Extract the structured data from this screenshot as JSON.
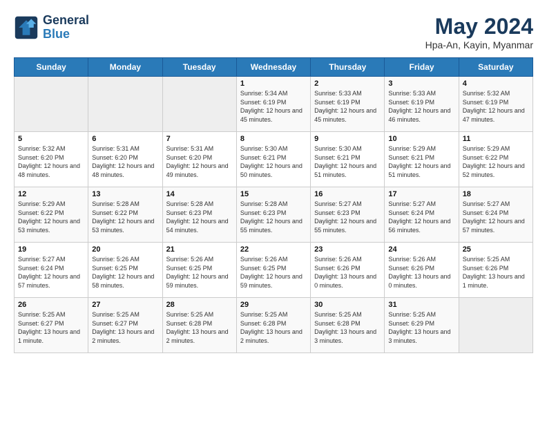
{
  "header": {
    "logo_line1": "General",
    "logo_line2": "Blue",
    "title": "May 2024",
    "subtitle": "Hpa-An, Kayin, Myanmar"
  },
  "days_of_week": [
    "Sunday",
    "Monday",
    "Tuesday",
    "Wednesday",
    "Thursday",
    "Friday",
    "Saturday"
  ],
  "weeks": [
    [
      {
        "day": "",
        "empty": true
      },
      {
        "day": "",
        "empty": true
      },
      {
        "day": "",
        "empty": true
      },
      {
        "day": "1",
        "sunrise": "5:34 AM",
        "sunset": "6:19 PM",
        "daylight": "12 hours and 45 minutes."
      },
      {
        "day": "2",
        "sunrise": "5:33 AM",
        "sunset": "6:19 PM",
        "daylight": "12 hours and 45 minutes."
      },
      {
        "day": "3",
        "sunrise": "5:33 AM",
        "sunset": "6:19 PM",
        "daylight": "12 hours and 46 minutes."
      },
      {
        "day": "4",
        "sunrise": "5:32 AM",
        "sunset": "6:19 PM",
        "daylight": "12 hours and 47 minutes."
      }
    ],
    [
      {
        "day": "5",
        "sunrise": "5:32 AM",
        "sunset": "6:20 PM",
        "daylight": "12 hours and 48 minutes."
      },
      {
        "day": "6",
        "sunrise": "5:31 AM",
        "sunset": "6:20 PM",
        "daylight": "12 hours and 48 minutes."
      },
      {
        "day": "7",
        "sunrise": "5:31 AM",
        "sunset": "6:20 PM",
        "daylight": "12 hours and 49 minutes."
      },
      {
        "day": "8",
        "sunrise": "5:30 AM",
        "sunset": "6:21 PM",
        "daylight": "12 hours and 50 minutes."
      },
      {
        "day": "9",
        "sunrise": "5:30 AM",
        "sunset": "6:21 PM",
        "daylight": "12 hours and 51 minutes."
      },
      {
        "day": "10",
        "sunrise": "5:29 AM",
        "sunset": "6:21 PM",
        "daylight": "12 hours and 51 minutes."
      },
      {
        "day": "11",
        "sunrise": "5:29 AM",
        "sunset": "6:22 PM",
        "daylight": "12 hours and 52 minutes."
      }
    ],
    [
      {
        "day": "12",
        "sunrise": "5:29 AM",
        "sunset": "6:22 PM",
        "daylight": "12 hours and 53 minutes."
      },
      {
        "day": "13",
        "sunrise": "5:28 AM",
        "sunset": "6:22 PM",
        "daylight": "12 hours and 53 minutes."
      },
      {
        "day": "14",
        "sunrise": "5:28 AM",
        "sunset": "6:23 PM",
        "daylight": "12 hours and 54 minutes."
      },
      {
        "day": "15",
        "sunrise": "5:28 AM",
        "sunset": "6:23 PM",
        "daylight": "12 hours and 55 minutes."
      },
      {
        "day": "16",
        "sunrise": "5:27 AM",
        "sunset": "6:23 PM",
        "daylight": "12 hours and 55 minutes."
      },
      {
        "day": "17",
        "sunrise": "5:27 AM",
        "sunset": "6:24 PM",
        "daylight": "12 hours and 56 minutes."
      },
      {
        "day": "18",
        "sunrise": "5:27 AM",
        "sunset": "6:24 PM",
        "daylight": "12 hours and 57 minutes."
      }
    ],
    [
      {
        "day": "19",
        "sunrise": "5:27 AM",
        "sunset": "6:24 PM",
        "daylight": "12 hours and 57 minutes."
      },
      {
        "day": "20",
        "sunrise": "5:26 AM",
        "sunset": "6:25 PM",
        "daylight": "12 hours and 58 minutes."
      },
      {
        "day": "21",
        "sunrise": "5:26 AM",
        "sunset": "6:25 PM",
        "daylight": "12 hours and 59 minutes."
      },
      {
        "day": "22",
        "sunrise": "5:26 AM",
        "sunset": "6:25 PM",
        "daylight": "12 hours and 59 minutes."
      },
      {
        "day": "23",
        "sunrise": "5:26 AM",
        "sunset": "6:26 PM",
        "daylight": "13 hours and 0 minutes."
      },
      {
        "day": "24",
        "sunrise": "5:26 AM",
        "sunset": "6:26 PM",
        "daylight": "13 hours and 0 minutes."
      },
      {
        "day": "25",
        "sunrise": "5:25 AM",
        "sunset": "6:26 PM",
        "daylight": "13 hours and 1 minute."
      }
    ],
    [
      {
        "day": "26",
        "sunrise": "5:25 AM",
        "sunset": "6:27 PM",
        "daylight": "13 hours and 1 minute."
      },
      {
        "day": "27",
        "sunrise": "5:25 AM",
        "sunset": "6:27 PM",
        "daylight": "13 hours and 2 minutes."
      },
      {
        "day": "28",
        "sunrise": "5:25 AM",
        "sunset": "6:28 PM",
        "daylight": "13 hours and 2 minutes."
      },
      {
        "day": "29",
        "sunrise": "5:25 AM",
        "sunset": "6:28 PM",
        "daylight": "13 hours and 2 minutes."
      },
      {
        "day": "30",
        "sunrise": "5:25 AM",
        "sunset": "6:28 PM",
        "daylight": "13 hours and 3 minutes."
      },
      {
        "day": "31",
        "sunrise": "5:25 AM",
        "sunset": "6:29 PM",
        "daylight": "13 hours and 3 minutes."
      },
      {
        "day": "",
        "empty": true
      }
    ]
  ]
}
